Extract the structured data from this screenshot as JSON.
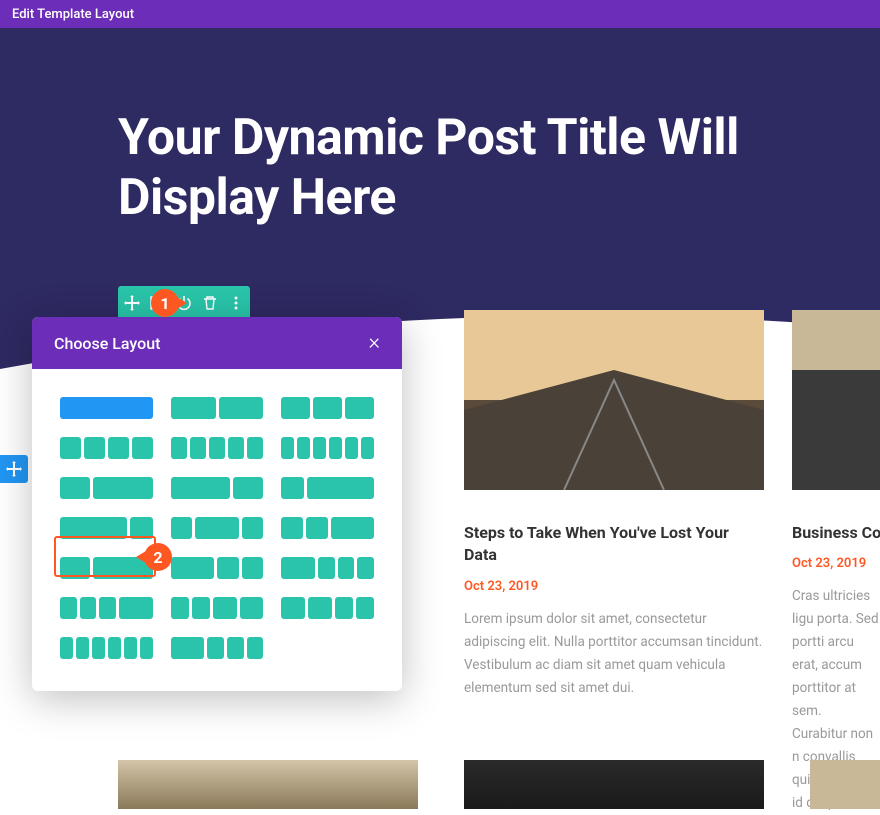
{
  "topbar": {
    "title": "Edit Template Layout"
  },
  "hero": {
    "title": "Your Dynamic Post Title Will Display Here"
  },
  "modal": {
    "title": "Choose Layout",
    "close": "×"
  },
  "markers": {
    "one": "1",
    "two": "2"
  },
  "posts": [
    {
      "title": "Steps to Take When You've Lost Your Data",
      "date": "Oct 23, 2019",
      "excerpt": "Lorem ipsum dolor sit amet, consectetur adipiscing elit. Nulla porttitor accumsan tincidunt. Vestibulum ac diam sit amet quam vehicula elementum sed sit amet dui."
    },
    {
      "title": "Business Coac",
      "date": "Oct 23, 2019",
      "excerpt": "Cras ultricies ligu porta. Sed portti arcu erat, accum porttitor at sem. Curabitur non n convallis quis ac quam id dui pos"
    }
  ],
  "colors": {
    "accent": "#6c2eb9",
    "teal": "#29c4a9",
    "blue": "#2196f3",
    "orange": "#ff5722"
  }
}
